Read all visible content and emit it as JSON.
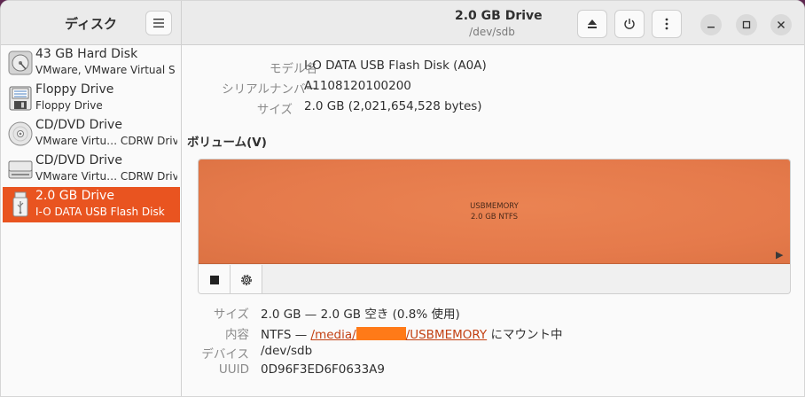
{
  "sidebar": {
    "title": "ディスク",
    "items": [
      {
        "name": "43 GB Hard Disk",
        "desc": "VMware, VMware Virtual S",
        "icon": "hard-disk-icon"
      },
      {
        "name": "Floppy Drive",
        "desc": "Floppy Drive",
        "icon": "floppy-icon"
      },
      {
        "name": "CD/DVD Drive",
        "desc": "VMware Virtu… CDRW Drive",
        "icon": "optical-disc-icon"
      },
      {
        "name": "CD/DVD Drive",
        "desc": "VMware Virtu… CDRW Drive",
        "icon": "optical-drive-icon"
      },
      {
        "name": "2.0 GB Drive",
        "desc": "I-O DATA USB Flash Disk",
        "icon": "usb-drive-icon",
        "selected": true
      }
    ]
  },
  "header": {
    "title": "2.0 GB Drive",
    "subtitle": "/dev/sdb"
  },
  "drive": {
    "model_label": "モデル名",
    "model_value": "I-O DATA USB Flash Disk (A0A)",
    "serial_label": "シリアルナンバー",
    "serial_value": "A1108120100200",
    "size_label": "サイズ",
    "size_value": "2.0 GB (2,021,654,528 bytes)"
  },
  "volumes": {
    "title": "ボリューム(V)",
    "partition_name": "USBMEMORY",
    "partition_size": "2.0 GB NTFS"
  },
  "volume_details": {
    "size_label": "サイズ",
    "size_value": "2.0 GB — 2.0 GB 空き (0.8% 使用)",
    "content_label": "内容",
    "content_prefix": "NTFS — ",
    "content_link_a": "/media/",
    "content_link_b": "/USBMEMORY",
    "content_suffix": " にマウント中",
    "device_label": "デバイス",
    "device_value": "/dev/sdb",
    "uuid_label": "UUID",
    "uuid_value": "0D96F3ED6F0633A9"
  },
  "colors": {
    "accent": "#e95420",
    "partition": "#e57a4b",
    "redaction": "#ff7a18"
  }
}
